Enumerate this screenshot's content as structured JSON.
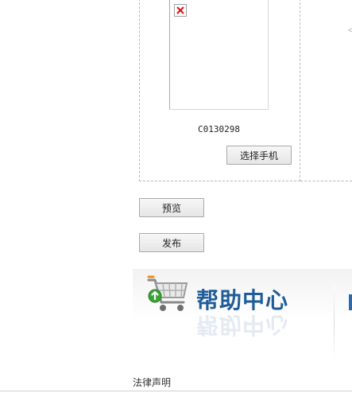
{
  "phone_panel": {
    "product_code": "C0130298",
    "choose_phone_label": "选择手机"
  },
  "actions": {
    "preview_label": "预览",
    "publish_label": "发布"
  },
  "help_banner": {
    "title": "帮助中心",
    "icon": "shopping-cart-icon",
    "accent_color": "#1f5d99"
  },
  "footer": {
    "legal_label": "法律声明"
  }
}
